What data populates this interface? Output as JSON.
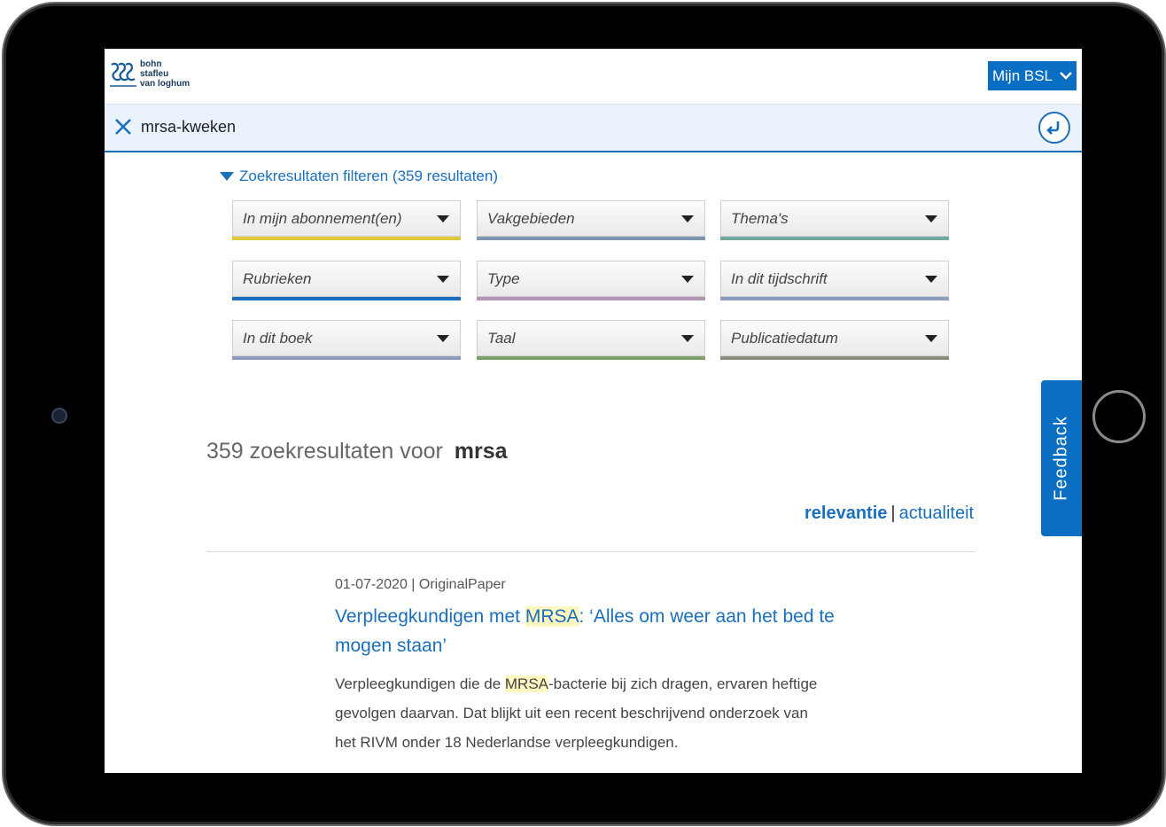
{
  "header": {
    "logo_lines": [
      "bohn",
      "stafleu",
      "van loghum"
    ],
    "account_button": "Mijn BSL"
  },
  "search": {
    "query": "mrsa-kweken"
  },
  "filters": {
    "toggle_label": "Zoekresultaten filteren (359 resultaten)",
    "dropdowns": [
      {
        "label": "In mijn abonnement(en)",
        "color": "#e2c93b"
      },
      {
        "label": "Vakgebieden",
        "color": "#7b96ad"
      },
      {
        "label": "Thema's",
        "color": "#6fa8a0"
      },
      {
        "label": "Rubrieken",
        "color": "#1a6fbd"
      },
      {
        "label": "Type",
        "color": "#b294b3"
      },
      {
        "label": "In dit tijdschrift",
        "color": "#8d9bbf"
      },
      {
        "label": "In dit boek",
        "color": "#8d9bbf"
      },
      {
        "label": "Taal",
        "color": "#7fa06a"
      },
      {
        "label": "Publicatiedatum",
        "color": "#8a8f7a"
      }
    ]
  },
  "results": {
    "count_text": "359 zoekresultaten voor",
    "term": "mrsa",
    "sort_relevance": "relevantie",
    "sort_separator": "|",
    "sort_recent": "actualiteit"
  },
  "result_item": {
    "meta": "01-07-2020 | OriginalPaper",
    "title_before": "Verpleegkundigen met ",
    "title_highlight": "MRSA",
    "title_after": ": ‘Alles om weer aan het bed te mogen staan’",
    "snippet_before": "Verpleegkundigen die de ",
    "snippet_highlight": "MRSA",
    "snippet_after": "-bacterie bij zich dragen, ervaren heftige gevolgen daarvan. Dat blijkt uit een recent beschrijvend onderzoek van het RIVM onder 18 Nederlandse verpleegkundigen."
  },
  "feedback_label": "Feedback",
  "icons": {
    "close": "close-icon",
    "enter": "enter-arrow-icon",
    "chevron": "chevron-down-icon",
    "logo": "bsl-logo-icon"
  }
}
